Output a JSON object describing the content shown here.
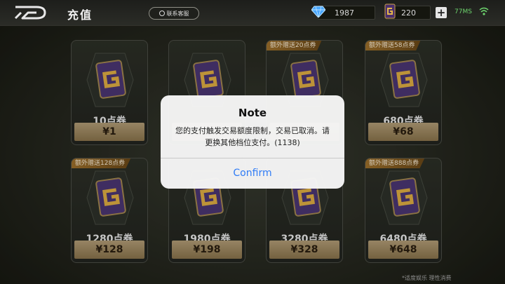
{
  "header": {
    "title": "充值",
    "service_label": "联系客服",
    "diamonds": "1987",
    "vouchers": "220",
    "ping": "77MS"
  },
  "products": [
    {
      "amount": "10点券",
      "price": "¥1",
      "bonus": ""
    },
    {
      "amount": "",
      "price": "",
      "bonus": ""
    },
    {
      "amount": "",
      "price": "",
      "bonus": "额外赠送20点券"
    },
    {
      "amount": "680点券",
      "price": "¥68",
      "bonus": "额外赠送58点券"
    },
    {
      "amount": "1280点券",
      "price": "¥128",
      "bonus": "额外赠送128点券"
    },
    {
      "amount": "1980点券",
      "price": "¥198",
      "bonus": ""
    },
    {
      "amount": "3280点券",
      "price": "¥328",
      "bonus": ""
    },
    {
      "amount": "6480点券",
      "price": "¥648",
      "bonus": "额外赠送888点券"
    }
  ],
  "dialog": {
    "title": "Note",
    "message": "您的支付触发交易额度限制，交易已取消。请更换其他档位支付。(1138)",
    "confirm_label": "Confirm"
  },
  "footer": {
    "note": "*适度娱乐 理性消费"
  },
  "colors": {
    "accent_blue": "#2f7cf6",
    "price_gold": "#b8a27a",
    "ping_green": "#6ed66e"
  }
}
